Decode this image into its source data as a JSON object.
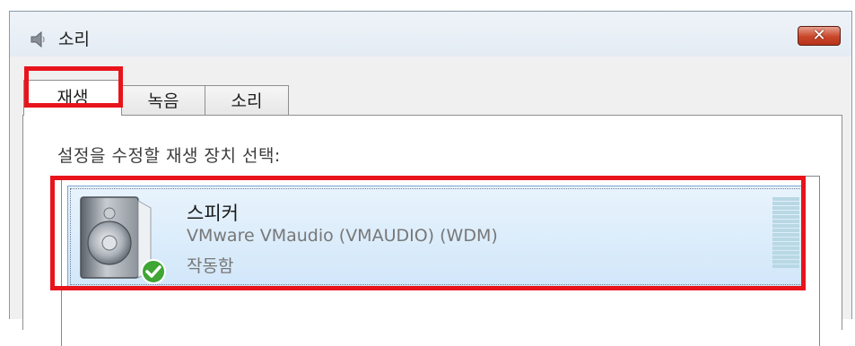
{
  "window": {
    "title": "소리",
    "close_label": "✕"
  },
  "tabs": [
    {
      "label": "재생",
      "active": true
    },
    {
      "label": "녹음",
      "active": false
    },
    {
      "label": "소리",
      "active": false
    }
  ],
  "playback": {
    "instruction": "설정을 수정할 재생 장치 선택:",
    "devices": [
      {
        "name": "스피커",
        "description": "VMware VMaudio (VMAUDIO) (WDM)",
        "status": "작동함",
        "icon": "speaker-icon",
        "status_icon": "default-check-icon"
      }
    ]
  },
  "colors": {
    "highlight": "#e8141b",
    "selection": "#d1e7fa",
    "close_button": "#c9462a"
  }
}
